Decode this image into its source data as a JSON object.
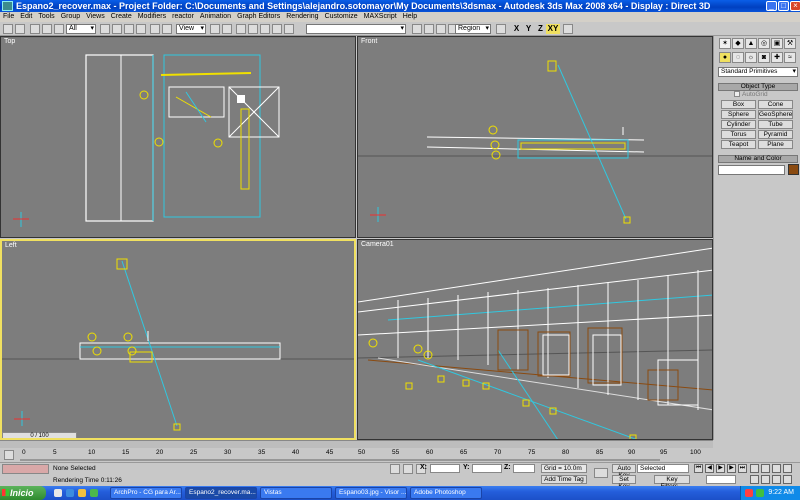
{
  "window": {
    "title": "Espano2_recover.max   - Project Folder: C:\\Documents and Settings\\alejandro.sotomayor\\My Documents\\3dsmax   - Autodesk 3ds Max 2008 x64   - Display : Direct 3D",
    "controls": [
      "_",
      "□",
      "×"
    ]
  },
  "menu": [
    "File",
    "Edit",
    "Tools",
    "Group",
    "Views",
    "Create",
    "Modifiers",
    "reactor",
    "Animation",
    "Graph Editors",
    "Rendering",
    "Customize",
    "MAXScript",
    "Help"
  ],
  "toolbar": {
    "filter_value": "All",
    "refcoord_value": "View",
    "selection_region": "Region",
    "axes": [
      "X",
      "Y",
      "Z",
      "XY"
    ]
  },
  "viewports": {
    "top_label": "Top",
    "front_label": "Front",
    "left_label": "Left",
    "camera_label": "Camera01"
  },
  "command_panel": {
    "category": "Standard Primitives",
    "object_type_header": "Object Type",
    "autogrid_label": "AutoGrid",
    "objects": [
      "Box",
      "Cone",
      "Sphere",
      "GeoSphere",
      "Cylinder",
      "Tube",
      "Torus",
      "Pyramid",
      "Teapot",
      "Plane"
    ],
    "name_color_header": "Name and Color"
  },
  "timeline": {
    "slider": "0 / 100",
    "ticks": [
      "0",
      "5",
      "10",
      "15",
      "20",
      "25",
      "30",
      "35",
      "40",
      "45",
      "50",
      "55",
      "60",
      "65",
      "70",
      "75",
      "80",
      "85",
      "90",
      "95",
      "100"
    ]
  },
  "status": {
    "selection": "None Selected",
    "rendering_time": "Rendering Time  0:11:26",
    "x_label": "X:",
    "y_label": "Y:",
    "z_label": "Z:",
    "grid": "Grid = 10.0m",
    "add_time_tag": "Add Time Tag",
    "auto_key": "Auto Key",
    "set_key": "Set Key",
    "selected": "Selected",
    "key_filters": "Key Filters..."
  },
  "taskbar": {
    "start": "Inicio",
    "items": [
      "ArchPro - CG para Ar...",
      "Espano2_recover.ma...",
      "Vistas",
      "Espano03.jpg - Visor ...",
      "Adobe Photoshop"
    ],
    "clock": "9:22 AM"
  },
  "colors": {
    "viewport_bg": "#7d7d7d",
    "active_border": "#f0e060",
    "geometry_white": "#ffffff",
    "helpers_yellow": "#f0e000",
    "cyan_lines": "#30c8e0",
    "brown_props": "#8a4a10"
  }
}
